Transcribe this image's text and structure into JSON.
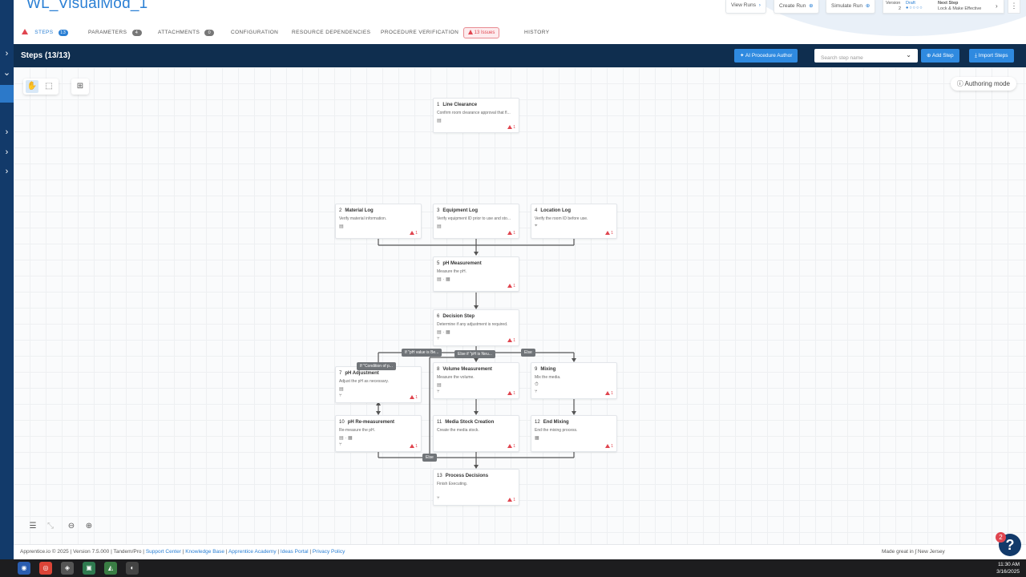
{
  "app": {
    "title": "WL_VisualMod_1",
    "header_buttons": {
      "view_runs": "View Runs",
      "create_run": "Create Run",
      "simulate_run": "Simulate Run"
    },
    "version": {
      "label": "Version",
      "status": "Draft",
      "number": "2",
      "next_step_label": "Next Step",
      "next_step_value": "Lock & Make Effective"
    }
  },
  "tabs": [
    {
      "label": "STEPS",
      "count": "13"
    },
    {
      "label": "PARAMETERS",
      "count": "4"
    },
    {
      "label": "ATTACHMENTS",
      "count": "0"
    },
    {
      "label": "CONFIGURATION"
    },
    {
      "label": "RESOURCE DEPENDENCIES"
    },
    {
      "label": "PROCEDURE VERIFICATION"
    },
    {
      "label": "13 Issues"
    },
    {
      "label": "HISTORY"
    }
  ],
  "toolbar": {
    "steps_title": "Steps (13/13)",
    "ai_button": "AI Procedure Author",
    "search_placeholder": "Search step name",
    "add_step": "Add Step",
    "import_steps": "Import Steps"
  },
  "canvas": {
    "authoring_mode": "Authoring mode"
  },
  "nodes": [
    {
      "num": "1",
      "title": "Line Clearance",
      "desc": "Confirm room clearance approval that fl...",
      "warn": "1"
    },
    {
      "num": "2",
      "title": "Material Log",
      "desc": "Verify material information.",
      "warn": "1"
    },
    {
      "num": "3",
      "title": "Equipment Log",
      "desc": "Verify equipment ID prior to use and sto...",
      "warn": "1"
    },
    {
      "num": "4",
      "title": "Location Log",
      "desc": "Verify the room ID before use.",
      "warn": "1"
    },
    {
      "num": "5",
      "title": "pH Measurement",
      "desc": "Measure the pH.",
      "warn": "1"
    },
    {
      "num": "6",
      "title": "Decision Step",
      "desc": "Determine if any adjustment is required.",
      "warn": "1"
    },
    {
      "num": "7",
      "title": "pH Adjustment",
      "desc": "Adjust the pH as necessary.",
      "warn": "1"
    },
    {
      "num": "8",
      "title": "Volume Measurement",
      "desc": "Measure the volume.",
      "warn": "1"
    },
    {
      "num": "9",
      "title": "Mixing",
      "desc": "Mix the media.",
      "warn": "1"
    },
    {
      "num": "10",
      "title": "pH Re-measurement",
      "desc": "Re-measure the pH.",
      "warn": "1"
    },
    {
      "num": "11",
      "title": "Media Stock Creation",
      "desc": "Create the media stock.",
      "warn": "1"
    },
    {
      "num": "12",
      "title": "End Mixing",
      "desc": "End the mixing process.",
      "warn": "1"
    },
    {
      "num": "13",
      "title": "Process Decisions",
      "desc": "Finish Executing.",
      "warn": "1"
    }
  ],
  "edge_labels": [
    "If \"pH value is Be...",
    "Else if \"pH is Neu...",
    "Else",
    "If \"Condition of p...",
    "Else"
  ],
  "footer": {
    "left_plain": "Apprentice.io © 2025 | Version 7.5.000 | Tandem/Pro | ",
    "links": [
      "Support Center",
      "Knowledge Base",
      "Apprentice Academy",
      "Ideas Portal",
      "Privacy Policy"
    ],
    "right": "Made great in",
    "right_place": "New Jersey"
  },
  "help": {
    "badge": "2",
    "icon": "?"
  },
  "taskbar": {
    "time": "11:30 AM",
    "date": "3/16/2025"
  },
  "colors": {
    "brand_blue": "#2a7fd4",
    "navy": "#0f2e4f",
    "rail": "#123a6a",
    "warning": "#e0454f"
  }
}
